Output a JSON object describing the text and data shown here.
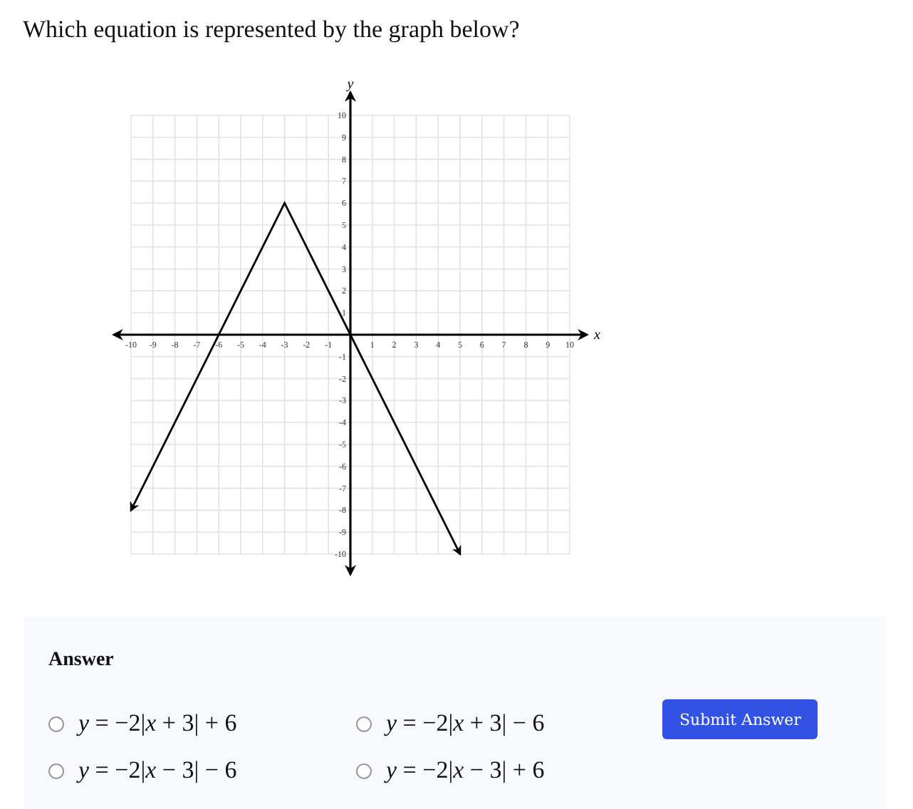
{
  "question": {
    "text": "Which equation is represented by the graph below?",
    "chart_data": {
      "type": "line",
      "xlabel": "x",
      "ylabel": "y",
      "x": [
        -10,
        -3,
        5
      ],
      "grid": true,
      "series": [
        {
          "color": "#000000",
          "values": [
            -8,
            6,
            -10
          ]
        }
      ],
      "xlim": [
        -10,
        10
      ],
      "ylim": [
        -10,
        10
      ],
      "xticks": [
        -10,
        -9,
        -8,
        -7,
        -6,
        -5,
        -4,
        -3,
        -2,
        -1,
        1,
        2,
        3,
        4,
        5,
        6,
        7,
        8,
        9,
        10
      ],
      "yticks": [
        -10,
        -9,
        -8,
        -7,
        -6,
        -5,
        -4,
        -3,
        -2,
        -1,
        1,
        2,
        3,
        4,
        5,
        6,
        7,
        8,
        9,
        10
      ]
    }
  },
  "answer": {
    "heading": "Answer",
    "options": [
      {
        "label": "*y* = −2|*x* + 3| + 6",
        "selected": false
      },
      {
        "label": "*y* = −2|*x* + 3| − 6",
        "selected": false
      },
      {
        "label": "*y* = −2|*x* − 3| − 6",
        "selected": false
      },
      {
        "label": "*y* = −2|*x* − 3| + 6",
        "selected": false
      }
    ],
    "submit": "Submit Answer"
  }
}
